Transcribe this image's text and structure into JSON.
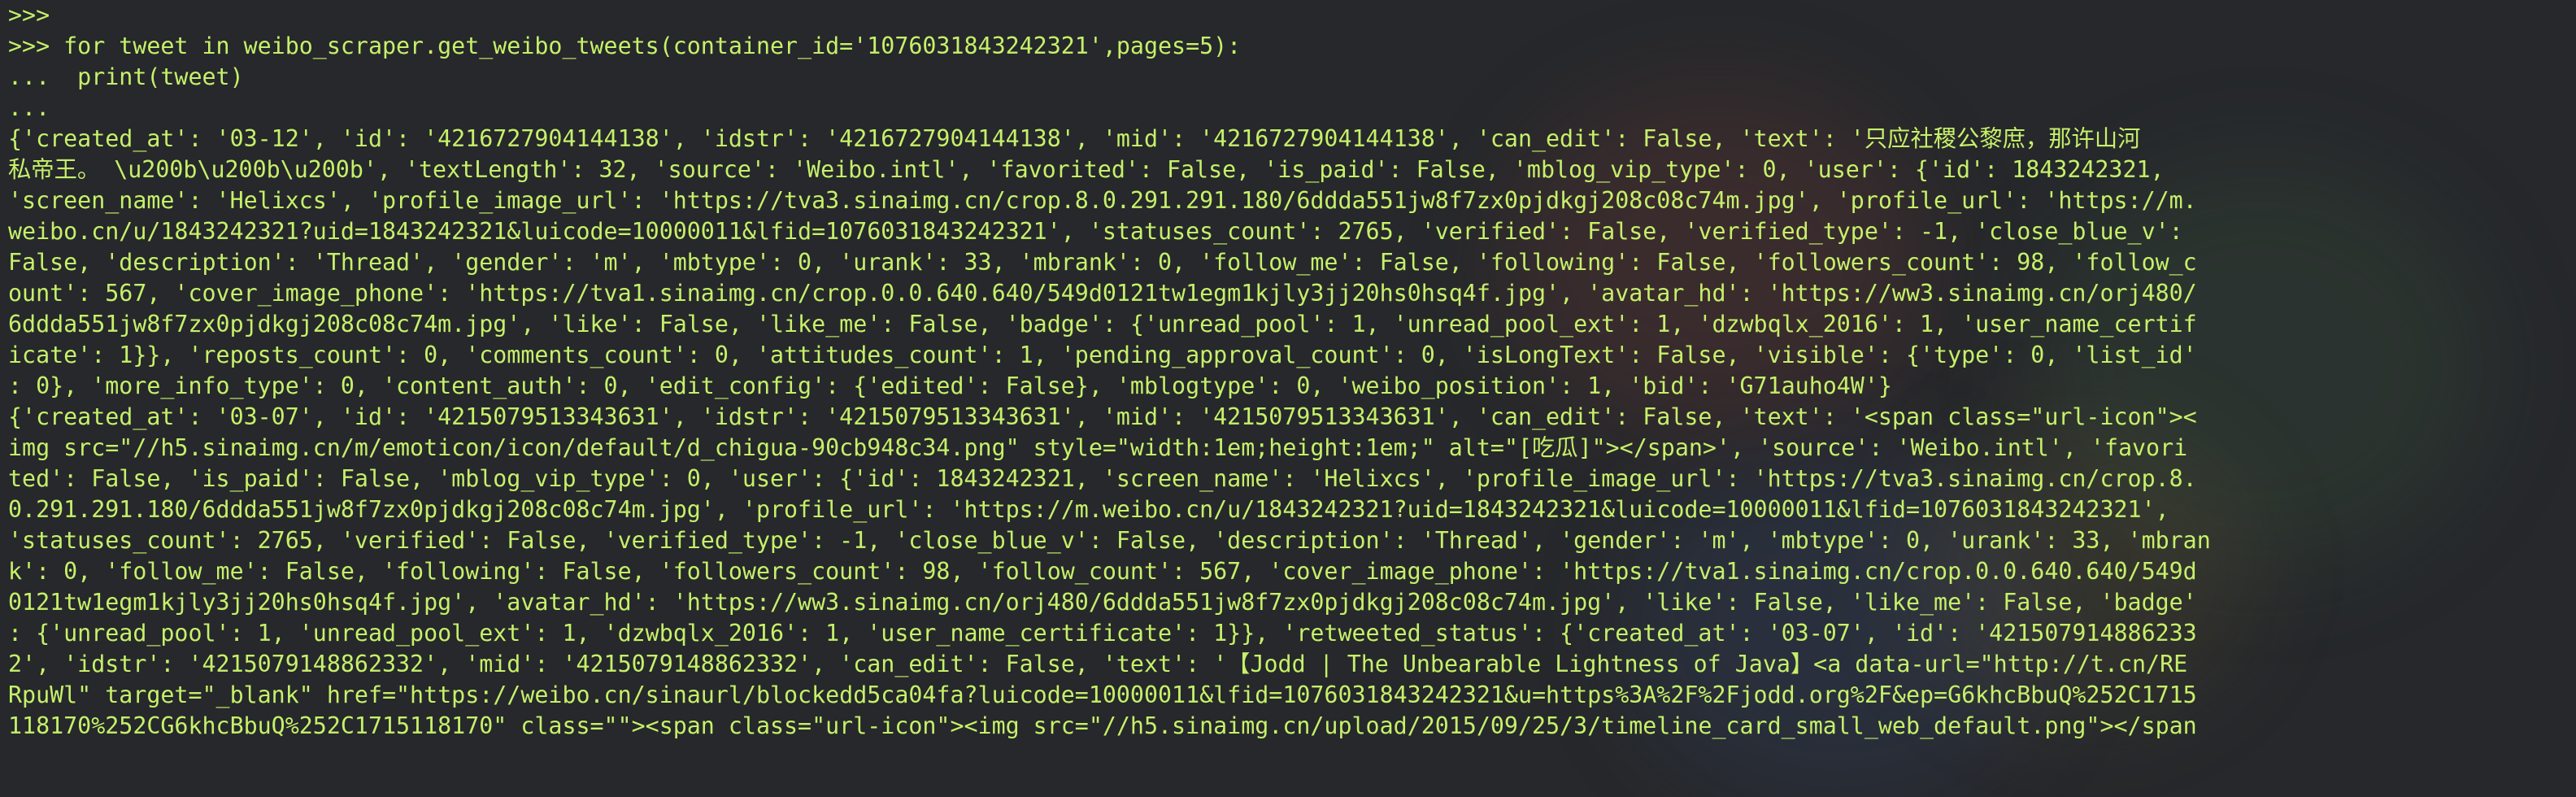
{
  "terminal": {
    "text_color": "#c6f06a",
    "background": "#26282b",
    "lines": [
      ">>>",
      ">>> for tweet in weibo_scraper.get_weibo_tweets(container_id='1076031843242321',pages=5):",
      "...  print(tweet)",
      "...",
      "{'created_at': '03-12', 'id': '4216727904144138', 'idstr': '4216727904144138', 'mid': '4216727904144138', 'can_edit': False, 'text': '只应社稷公黎庶，那许山河",
      "私帝王。 \\u200b\\u200b\\u200b', 'textLength': 32, 'source': 'Weibo.intl', 'favorited': False, 'is_paid': False, 'mblog_vip_type': 0, 'user': {'id': 1843242321,",
      "'screen_name': 'Helixcs', 'profile_image_url': 'https://tva3.sinaimg.cn/crop.8.0.291.291.180/6ddda551jw8f7zx0pjdkgj208c08c74m.jpg', 'profile_url': 'https://m.",
      "weibo.cn/u/1843242321?uid=1843242321&luicode=10000011&lfid=1076031843242321', 'statuses_count': 2765, 'verified': False, 'verified_type': -1, 'close_blue_v':",
      "False, 'description': 'Thread', 'gender': 'm', 'mbtype': 0, 'urank': 33, 'mbrank': 0, 'follow_me': False, 'following': False, 'followers_count': 98, 'follow_c",
      "ount': 567, 'cover_image_phone': 'https://tva1.sinaimg.cn/crop.0.0.640.640/549d0121tw1egm1kjly3jj20hs0hsq4f.jpg', 'avatar_hd': 'https://ww3.sinaimg.cn/orj480/",
      "6ddda551jw8f7zx0pjdkgj208c08c74m.jpg', 'like': False, 'like_me': False, 'badge': {'unread_pool': 1, 'unread_pool_ext': 1, 'dzwbqlx_2016': 1, 'user_name_certif",
      "icate': 1}}, 'reposts_count': 0, 'comments_count': 0, 'attitudes_count': 1, 'pending_approval_count': 0, 'isLongText': False, 'visible': {'type': 0, 'list_id'",
      ": 0}, 'more_info_type': 0, 'content_auth': 0, 'edit_config': {'edited': False}, 'mblogtype': 0, 'weibo_position': 1, 'bid': 'G71auho4W'}",
      "{'created_at': '03-07', 'id': '4215079513343631', 'idstr': '4215079513343631', 'mid': '4215079513343631', 'can_edit': False, 'text': '<span class=\"url-icon\"><",
      "img src=\"//h5.sinaimg.cn/m/emoticon/icon/default/d_chigua-90cb948c34.png\" style=\"width:1em;height:1em;\" alt=\"[吃瓜]\"></span>', 'source': 'Weibo.intl', 'favori",
      "ted': False, 'is_paid': False, 'mblog_vip_type': 0, 'user': {'id': 1843242321, 'screen_name': 'Helixcs', 'profile_image_url': 'https://tva3.sinaimg.cn/crop.8.",
      "0.291.291.180/6ddda551jw8f7zx0pjdkgj208c08c74m.jpg', 'profile_url': 'https://m.weibo.cn/u/1843242321?uid=1843242321&luicode=10000011&lfid=1076031843242321',",
      "'statuses_count': 2765, 'verified': False, 'verified_type': -1, 'close_blue_v': False, 'description': 'Thread', 'gender': 'm', 'mbtype': 0, 'urank': 33, 'mbran",
      "k': 0, 'follow_me': False, 'following': False, 'followers_count': 98, 'follow_count': 567, 'cover_image_phone': 'https://tva1.sinaimg.cn/crop.0.0.640.640/549d",
      "0121tw1egm1kjly3jj20hs0hsq4f.jpg', 'avatar_hd': 'https://ww3.sinaimg.cn/orj480/6ddda551jw8f7zx0pjdkgj208c08c74m.jpg', 'like': False, 'like_me': False, 'badge'",
      ": {'unread_pool': 1, 'unread_pool_ext': 1, 'dzwbqlx_2016': 1, 'user_name_certificate': 1}}, 'retweeted_status': {'created_at': '03-07', 'id': '421507914886233",
      "2', 'idstr': '4215079148862332', 'mid': '4215079148862332', 'can_edit': False, 'text': '【Jodd | The Unbearable Lightness of Java】<a data-url=\"http://t.cn/RE",
      "RpuWl\" target=\"_blank\" href=\"https://weibo.cn/sinaurl/blockedd5ca04fa?luicode=10000011&lfid=1076031843242321&u=https%3A%2F%2Fjodd.org%2F&ep=G6khcBbuQ%252C1715",
      "118170%252CG6khcBbuQ%252C1715118170\" class=\"\"><span class=\"url-icon\"><img src=\"//h5.sinaimg.cn/upload/2015/09/25/3/timeline_card_small_web_default.png\"></span"
    ]
  }
}
